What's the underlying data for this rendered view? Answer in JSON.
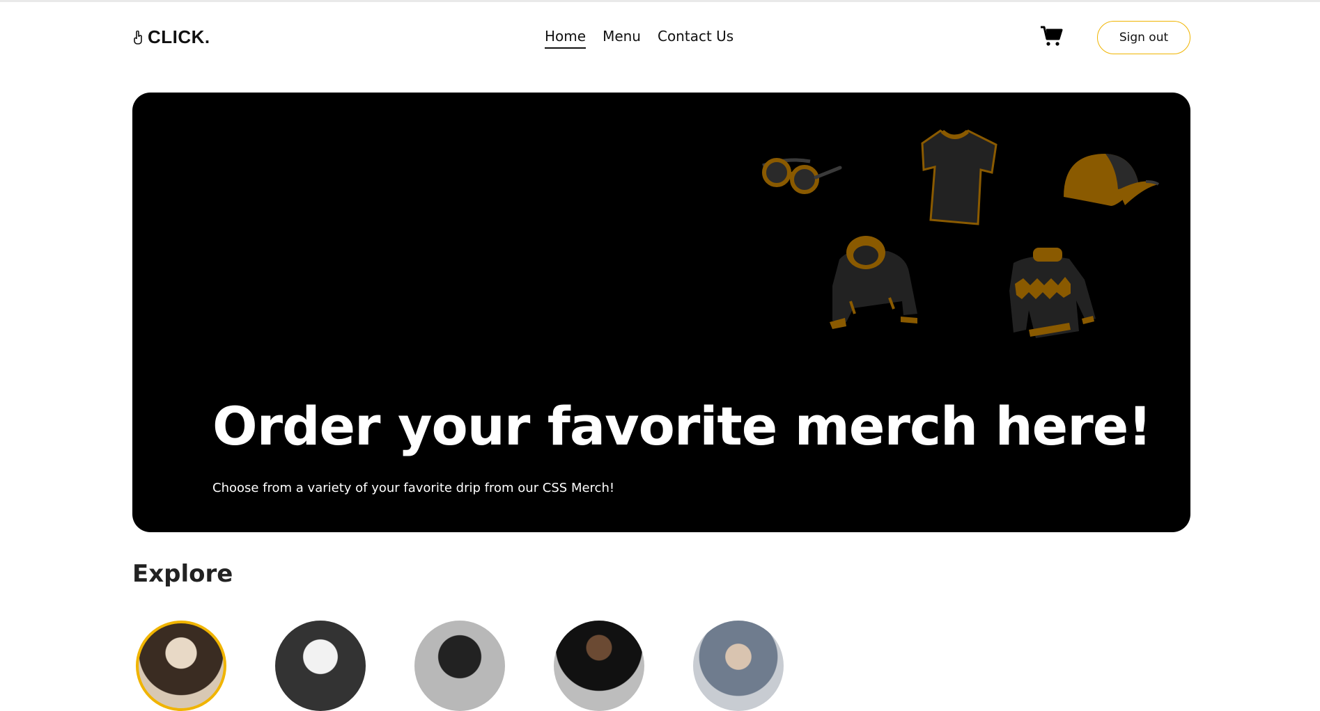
{
  "brand": {
    "name": "CLICK."
  },
  "nav": {
    "items": [
      {
        "label": "Home",
        "active": true
      },
      {
        "label": "Menu",
        "active": false
      },
      {
        "label": "Contact Us",
        "active": false
      }
    ]
  },
  "header": {
    "signout_label": "Sign out",
    "cart_icon": "cart-icon"
  },
  "hero": {
    "title": "Order your favorite merch here!",
    "subtitle": "Choose from a variety of your favorite drip from our CSS Merch!",
    "items": [
      "sunglasses-icon",
      "tshirt-icon",
      "cap-icon",
      "hoodie-icon",
      "sweater-icon"
    ]
  },
  "explore": {
    "title": "Explore",
    "categories": [
      {
        "icon": "category-photo-1",
        "selected": true
      },
      {
        "icon": "category-photo-2",
        "selected": false
      },
      {
        "icon": "category-photo-3",
        "selected": false
      },
      {
        "icon": "category-photo-4",
        "selected": false
      },
      {
        "icon": "category-photo-5",
        "selected": false
      }
    ]
  },
  "colors": {
    "accent": "#f0b400",
    "merch_gold": "#8a5a00",
    "merch_dark": "#222222",
    "hero_bg": "#000000"
  }
}
